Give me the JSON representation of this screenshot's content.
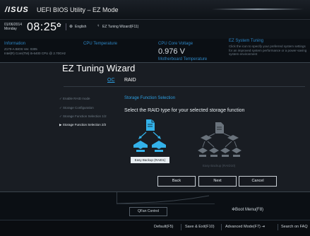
{
  "header": {
    "brand": "/ISUS",
    "title": "UEFI BIOS Utility – EZ Mode"
  },
  "inforow": {
    "date": "01/06/2014",
    "day": "Monday",
    "time": "08:25",
    "language": "English",
    "wizard_link": "EZ Tuning Wizard(F11)"
  },
  "dashboard": {
    "information_label": "Information",
    "information_lines": [
      "Z170-A   BIOS Ver. 0305",
      "Intel(R) Core(TM) i5-6400 CPU @ 2.70GHz"
    ],
    "cpu_temp_label": "CPU Temperature",
    "cpu_voltage_label": "CPU Core Voltage",
    "cpu_voltage_value": "0.976 V",
    "mb_temp_label": "Motherboard Temperature",
    "tuning_label": "EZ System Tuning",
    "tuning_desc": "Click the icon to specify your preferred system settings for an improved system performance or a power-saving system environment"
  },
  "wizard": {
    "title": "EZ Tuning Wizard",
    "tabs": [
      {
        "label": "OC"
      },
      {
        "label": "RAID"
      }
    ],
    "steps": [
      {
        "label": "Enable RAID mode"
      },
      {
        "label": "Storage Configuration"
      },
      {
        "label": "Storage Function Selection 1/2"
      },
      {
        "label": "Storage Function Selection 2/2"
      }
    ],
    "section_title": "Storage Function Selection",
    "section_desc": "Select the RAID type for your selected storage function",
    "options": [
      {
        "label": "Easy Backup (RAID1)"
      },
      {
        "label": "Easy Backup (RAID10)"
      }
    ],
    "buttons": {
      "back": "Back",
      "next": "Next",
      "cancel": "Cancel"
    }
  },
  "lower": {
    "qfan": "QFan Control",
    "boot_menu": "Boot Menu(F8)"
  },
  "footer": {
    "items": [
      "Default(F5)",
      "Save & Exit(F10)",
      "Advanced Mode(F7)",
      "Search on FAQ"
    ]
  },
  "colors": {
    "accent": "#2d9ee0",
    "background": "#0b0f14",
    "modal": "#1a1e24"
  }
}
